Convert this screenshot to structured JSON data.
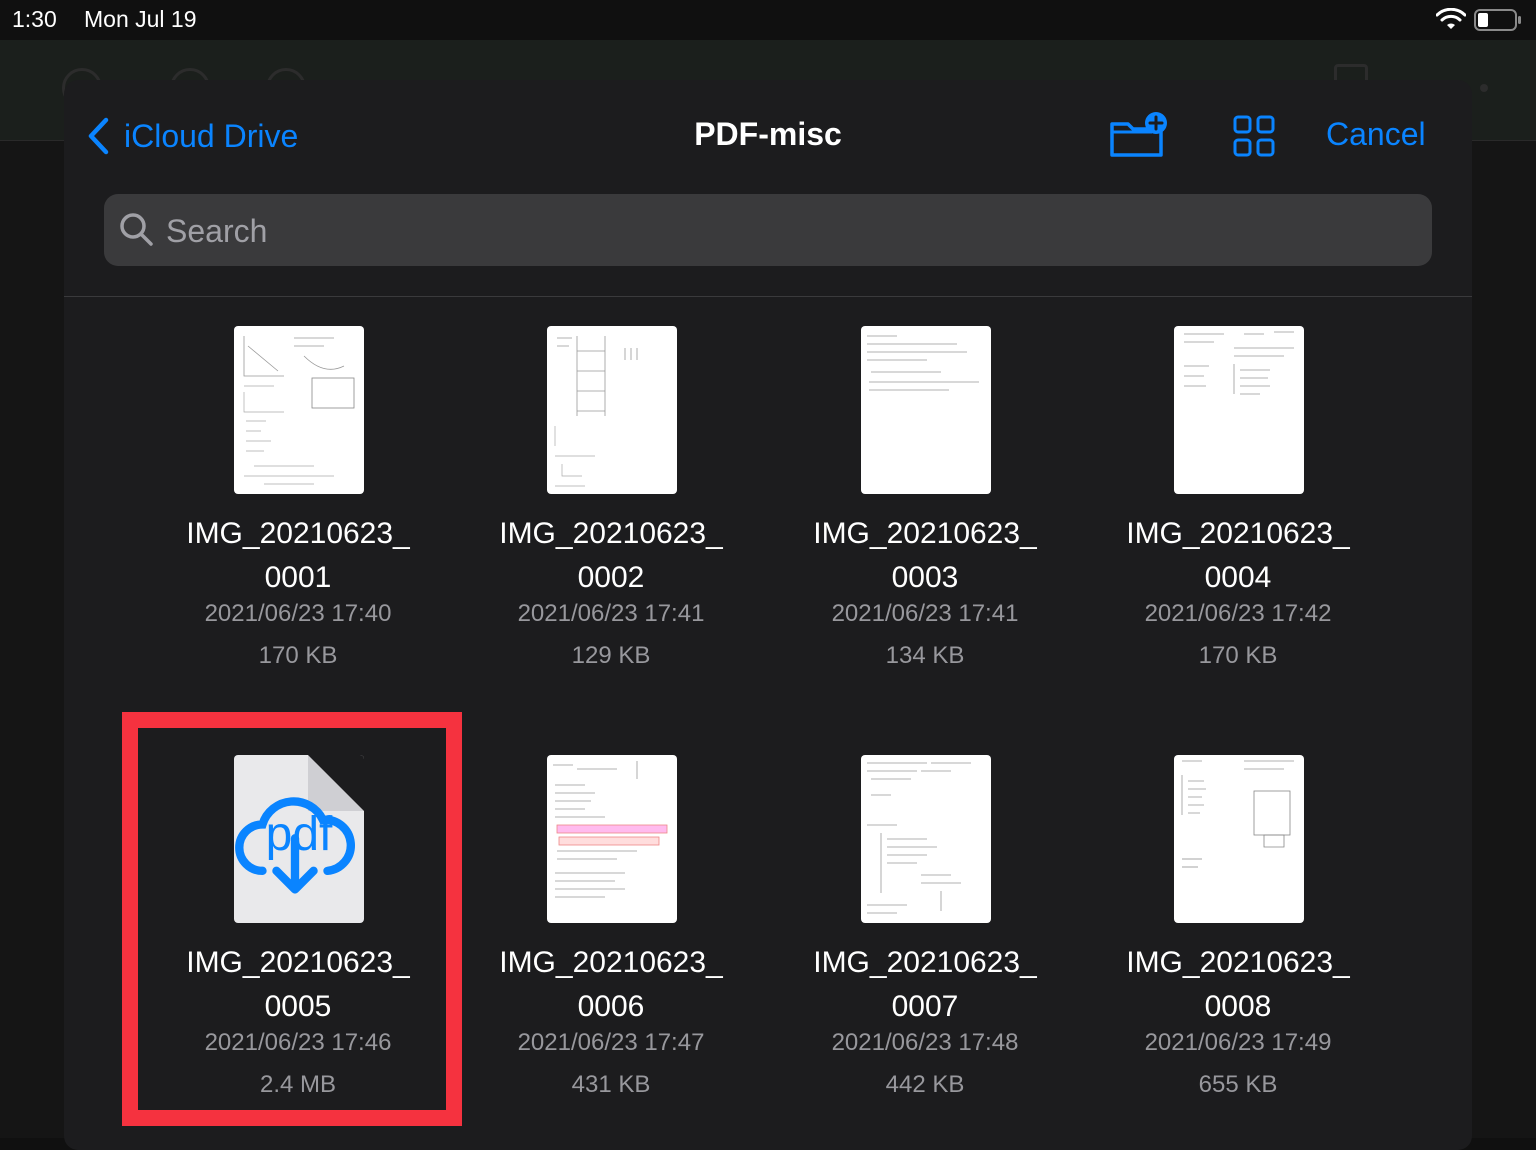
{
  "status": {
    "time": "1:30",
    "date": "Mon Jul 19"
  },
  "nav": {
    "back_label": "iCloud Drive",
    "title": "PDF-misc",
    "cancel_label": "Cancel"
  },
  "search": {
    "placeholder": "Search"
  },
  "files": [
    {
      "name_line1": "IMG_20210623_",
      "name_line2": "0001",
      "date": "2021/06/23 17:40",
      "size": "170 KB"
    },
    {
      "name_line1": "IMG_20210623_",
      "name_line2": "0002",
      "date": "2021/06/23 17:41",
      "size": "129 KB"
    },
    {
      "name_line1": "IMG_20210623_",
      "name_line2": "0003",
      "date": "2021/06/23 17:41",
      "size": "134 KB"
    },
    {
      "name_line1": "IMG_20210623_",
      "name_line2": "0004",
      "date": "2021/06/23 17:42",
      "size": "170 KB"
    },
    {
      "name_line1": "IMG_20210623_",
      "name_line2": "0005",
      "date": "2021/06/23 17:46",
      "size": "2.4 MB",
      "thumb_label": "pdf"
    },
    {
      "name_line1": "IMG_20210623_",
      "name_line2": "0006",
      "date": "2021/06/23 17:47",
      "size": "431 KB"
    },
    {
      "name_line1": "IMG_20210623_",
      "name_line2": "0007",
      "date": "2021/06/23 17:48",
      "size": "442 KB"
    },
    {
      "name_line1": "IMG_20210623_",
      "name_line2": "0008",
      "date": "2021/06/23 17:49",
      "size": "655 KB"
    }
  ],
  "colors": {
    "accent": "#0a84ff",
    "highlight": "#f5323f",
    "sheet": "#1c1c1e"
  },
  "icons": [
    "chevron-left-icon",
    "new-folder-icon",
    "grid-view-icon",
    "search-icon",
    "cloud-download-icon",
    "wifi-icon",
    "battery-icon"
  ]
}
